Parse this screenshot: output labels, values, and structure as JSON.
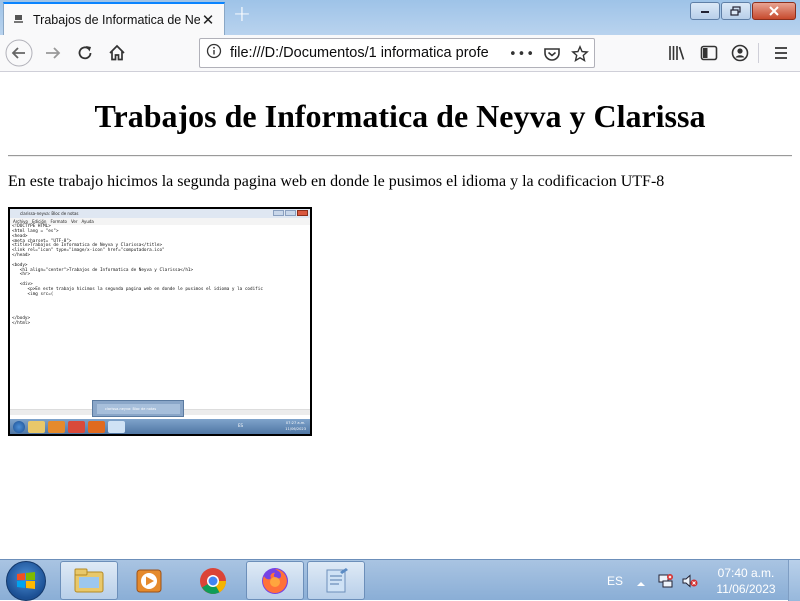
{
  "browser": {
    "tab_title": "Trabajos de Informatica de Neyva",
    "tab_close_glyph": "✕",
    "new_tab_glyph": "+",
    "url": "file:///D:/Documentos/1 informatica profe",
    "page_actions_glyph": "•••",
    "icons": [
      "back-icon",
      "forward-icon",
      "reload-icon",
      "home-icon",
      "info-icon",
      "pocket-icon",
      "bookmark-star-icon",
      "library-icon",
      "sidebar-icon",
      "account-icon",
      "menu-icon"
    ],
    "accent": "#0a84ff"
  },
  "page": {
    "title": "Trabajos de Informatica de Neyva y Clarissa",
    "paragraph": "En este trabajo hicimos la segunda pagina web en donde le pusimos el idioma y la codificacion UTF-8",
    "image": {
      "window_title": "clarissa-neyva: Bloc de notas",
      "menu": [
        "Archivo",
        "Edición",
        "Formato",
        "Ver",
        "Ayuda"
      ],
      "code": "<!DOCTYPE HTML>\n<html lang = \"es\">\n<head>\n<meta charset= \"UTF-8\">\n<title>Trabajos de Informatica de Neyva y Clarissa</title>\n<link rel=\"icon\" type=\"image/x-icon\" href=\"computadora.ico\"\n</head>\n\n<body>\n   <h1 align=\"center\">Trabajos de Informatica de Neyva y Clarissa</h1>\n   <hr>\n\n   <div>\n      <p>En este trabajo hicimos la segunda pagina web en donde le pusimos el idioma y la codific\n      <img src=(\n\n\n\n\n</body>\n</html>",
      "popup": "clarissa-neyva: Bloc de notas",
      "lang": "ES",
      "time": "07:27 a.m.",
      "date": "11/06/2023"
    }
  },
  "taskbar": {
    "lang": "ES",
    "time": "07:40 a.m.",
    "date": "11/06/2023",
    "apps": [
      "explorer-icon",
      "media-player-icon",
      "chrome-icon",
      "firefox-icon",
      "notepad-icon"
    ]
  }
}
